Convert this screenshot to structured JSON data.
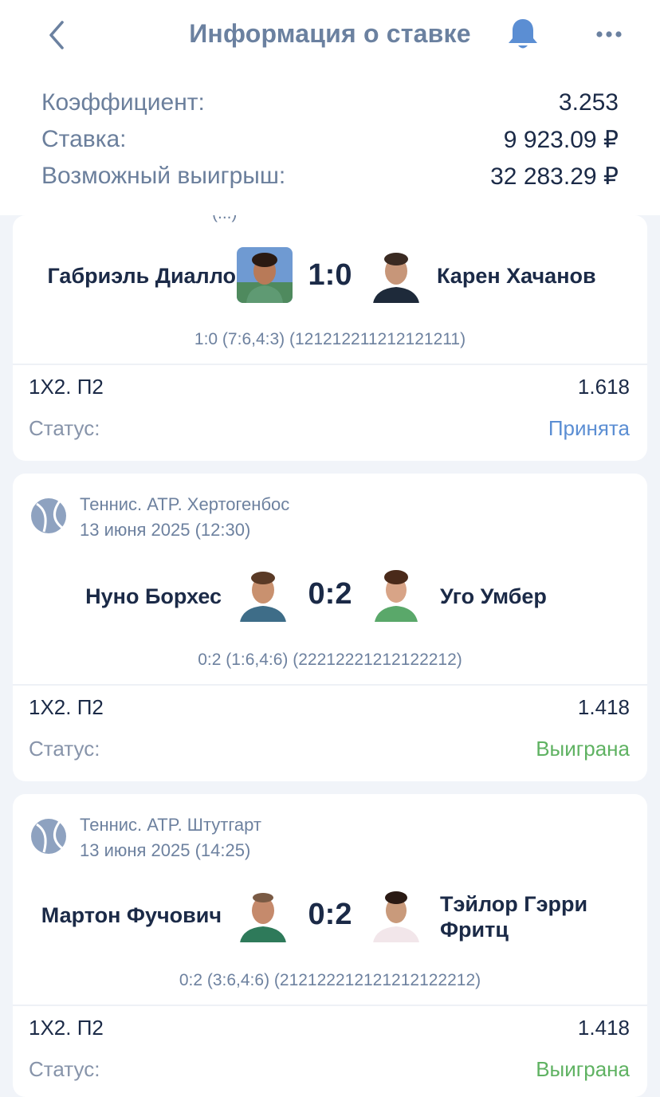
{
  "header": {
    "title": "Информация о ставке",
    "back_icon": "chevron-left-icon",
    "bell_icon": "bell-icon",
    "more_icon": "more-horizontal-icon",
    "accent": "#5b8ed3"
  },
  "summary": {
    "coefficient_label": "Коэффициент:",
    "coefficient_value": "3.253",
    "stake_label": "Ставка:",
    "stake_value": "9 923.09 ₽",
    "win_label": "Возможный выигрыш:",
    "win_value": "32 283.29 ₽"
  },
  "events": [
    {
      "league": "",
      "date_cut": "(...)",
      "player1": "Габриэль Диалло",
      "player2": "Карен Хачанов",
      "score": "1:0",
      "details": "1:0 (7:6,4:3) (121212211212121211)",
      "market": "1Х2. П2",
      "odd": "1.618",
      "status_label": "Статус:",
      "status": "Принята",
      "status_color": "#5b8ed3"
    },
    {
      "league": "Теннис. ATP. Хертогенбос",
      "date": "13 июня 2025 (12:30)",
      "player1": "Нуно Борхес",
      "player2": "Уго Умбер",
      "score": "0:2",
      "details": "0:2 (1:6,4:6) (22212221212122212)",
      "market": "1Х2. П2",
      "odd": "1.418",
      "status_label": "Статус:",
      "status": "Выиграна",
      "status_color": "#5fb262"
    },
    {
      "league": "Теннис. ATP. Штутгарт",
      "date": "13 июня 2025 (14:25)",
      "player1": "Мартон Фучович",
      "player2": "Тэйлор Гэрри Фритц",
      "score": "0:2",
      "details": "0:2 (3:6,4:6) (212122212121212122212)",
      "market": "1Х2. П2",
      "odd": "1.418",
      "status_label": "Статус:",
      "status": "Выиграна",
      "status_color": "#5fb262"
    }
  ]
}
